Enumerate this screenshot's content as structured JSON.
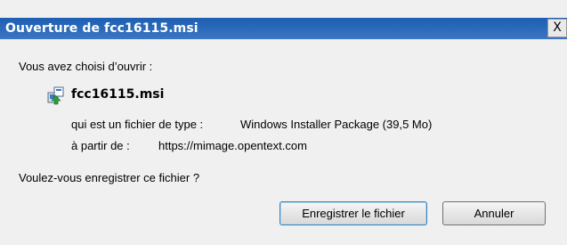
{
  "dialog": {
    "title": "Ouverture de fcc16115.msi",
    "close_label": "X",
    "intro": "Vous avez choisi d’ouvrir :",
    "file_name": "fcc16115.msi",
    "file_type_label": "qui est un fichier de type :",
    "file_type_value": "Windows Installer Package (39,5 Mo)",
    "source_label": "à partir de :",
    "source_value": "https://mimage.opentext.com",
    "question": "Voulez-vous enregistrer ce fichier ?",
    "buttons": {
      "save": "Enregistrer le fichier",
      "cancel": "Annuler"
    },
    "icon": "msi-installer-icon",
    "colors": {
      "titlebar": "#2a68b8",
      "background": "#f0f0f0"
    }
  }
}
